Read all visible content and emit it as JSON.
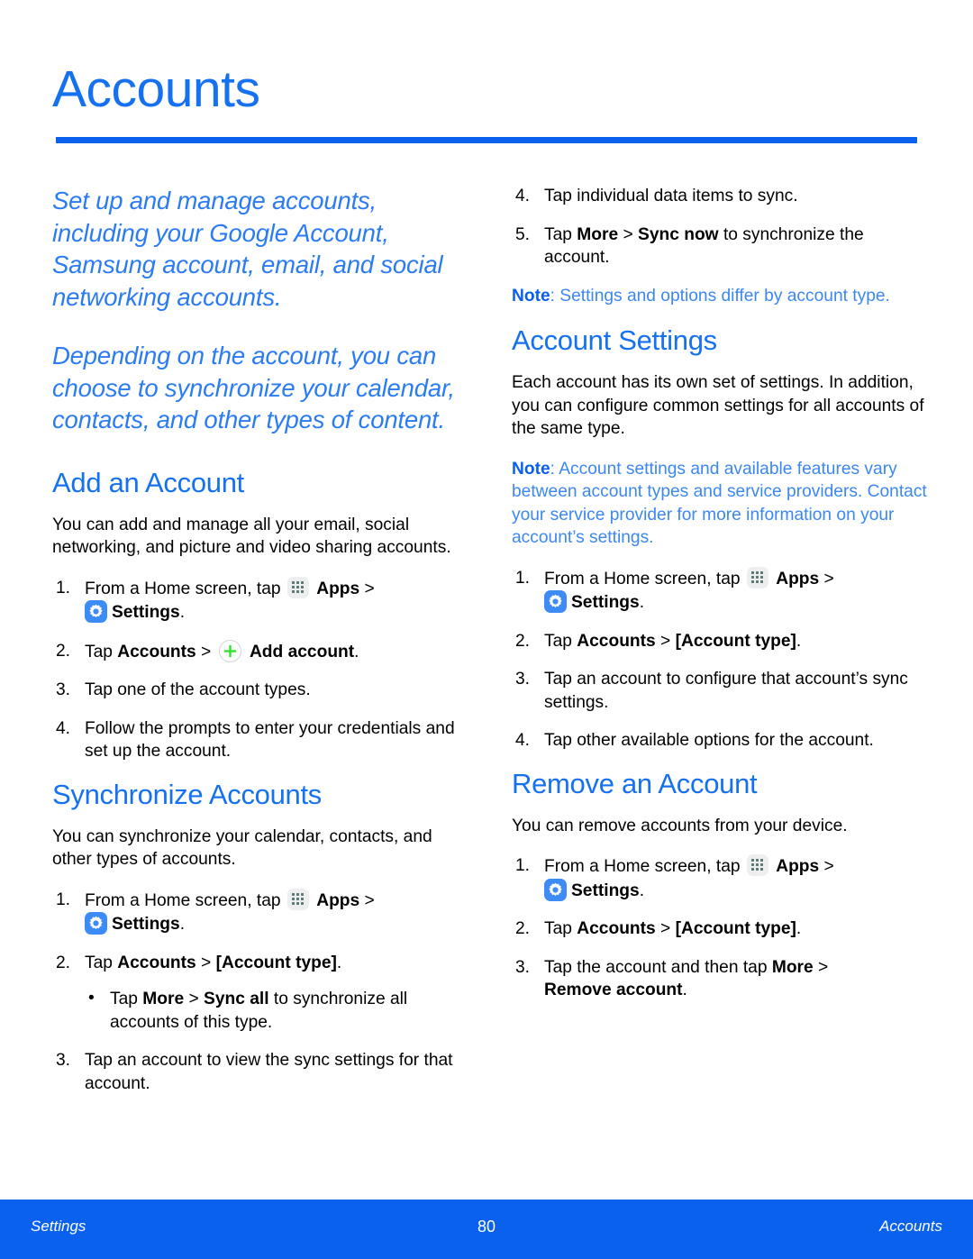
{
  "document": {
    "title": "Accounts",
    "accent_color": "#0a61ee",
    "heading_color": "#1671f0",
    "lead_color": "#2b7bf3",
    "note_color": "#3c87f0"
  },
  "lead": {
    "paragraph1": "Set up and manage accounts, including your Google Account, Samsung account, email, and social networking accounts.",
    "paragraph2": "Depending on the account, you can choose to synchronize your calendar, contacts, and other types of content."
  },
  "add_account": {
    "heading": "Add an Account",
    "intro": "You can add and manage all your email, social networking, and picture and video sharing accounts.",
    "step1": {
      "num": "1.",
      "pre": "From a Home screen, tap",
      "apps_label": "Apps",
      "chevron": ">",
      "settings_label": "Settings",
      "period": "."
    },
    "step2": {
      "num": "2.",
      "pre": "Tap",
      "accounts_label": "Accounts",
      "chevron": ">",
      "add_label": "Add account",
      "period": "."
    },
    "step3": {
      "num": "3.",
      "text": "Tap one of the account types."
    },
    "step4": {
      "num": "4.",
      "text": "Follow the prompts to enter your credentials and set up the account."
    }
  },
  "synchronize_accounts": {
    "heading": "Synchronize Accounts",
    "intro": "You can synchronize your calendar, contacts, and other types of accounts.",
    "step1": {
      "num": "1.",
      "pre": "From a Home screen, tap",
      "apps_label": "Apps",
      "chevron": ">",
      "settings_label": "Settings",
      "period": "."
    },
    "step2": {
      "num": "2.",
      "pre": "Tap",
      "accounts_label": "Accounts",
      "chevron": ">",
      "type_label": "[Account type]",
      "period": "."
    },
    "substep": {
      "bullet": "•",
      "pre": "Tap",
      "more_label": "More",
      "chevron": ">",
      "sync_label": "Sync all",
      "post": "to synchronize all accounts of this type."
    },
    "step3": {
      "num": "3.",
      "text": "Tap an account to view the sync settings for that account."
    },
    "step4": {
      "num": "4.",
      "text": "Tap individual data items to sync."
    },
    "step5": {
      "num": "5.",
      "pre": "Tap",
      "more_label": "More",
      "chevron": ">",
      "sync_now_label": "Sync now",
      "post": "to synchronize the account."
    },
    "note": {
      "label": "Note",
      "text": ": Settings and options differ by account type."
    }
  },
  "account_settings": {
    "heading": "Account Settings",
    "intro": "Each account has its own set of settings. In addition, you can configure common settings for all accounts of the same type.",
    "note": {
      "label": "Note",
      "text": ": Account settings and available features vary between account types and service providers. Contact your service provider for more information on your account’s settings."
    },
    "step1": {
      "num": "1.",
      "pre": "From a Home screen, tap",
      "apps_label": "Apps",
      "chevron": ">",
      "settings_label": "Settings",
      "period": "."
    },
    "step2": {
      "num": "2.",
      "pre": "Tap",
      "accounts_label": "Accounts",
      "chevron": ">",
      "type_label": "[Account type]",
      "period": "."
    },
    "step3": {
      "num": "3.",
      "text": "Tap an account to configure that account’s sync settings."
    },
    "step4": {
      "num": "4.",
      "text": "Tap other available options for the account."
    }
  },
  "remove_account": {
    "heading": "Remove an Account",
    "intro": "You can remove accounts from your device.",
    "step1": {
      "num": "1.",
      "pre": "From a Home screen, tap",
      "apps_label": "Apps",
      "chevron": ">",
      "settings_label": "Settings",
      "period": "."
    },
    "step2": {
      "num": "2.",
      "pre": "Tap",
      "accounts_label": "Accounts",
      "chevron": ">",
      "type_label": "[Account type]",
      "period": "."
    },
    "step3": {
      "num": "3.",
      "pre": "Tap the account and then tap",
      "more_label": "More",
      "chevron": ">",
      "remove_label": "Remove account",
      "period": "."
    }
  },
  "footer": {
    "left": "Settings",
    "page_number": "80",
    "right": "Accounts"
  }
}
